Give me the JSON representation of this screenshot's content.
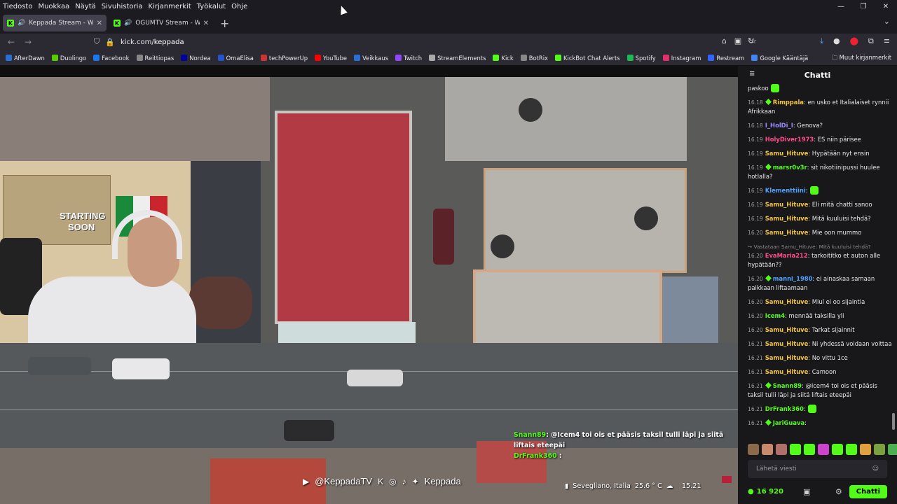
{
  "menubar": [
    "Tiedosto",
    "Muokkaa",
    "Näytä",
    "Sivuhistoria",
    "Kirjanmerkit",
    "Työkalut",
    "Ohje"
  ],
  "tabs": [
    {
      "title": "Keppada Stream - Watch Li"
    },
    {
      "title": "OGUMTV Stream - Watch L"
    }
  ],
  "url": {
    "host": "kick.com/",
    "path": "keppada"
  },
  "bookmarks": [
    {
      "label": "AfterDawn",
      "color": "#2a6fd6"
    },
    {
      "label": "Duolingo",
      "color": "#58cc02"
    },
    {
      "label": "Facebook",
      "color": "#1877f2"
    },
    {
      "label": "Reittiopas",
      "color": "#888888"
    },
    {
      "label": "Nordea",
      "color": "#0000a0"
    },
    {
      "label": "OmaElisa",
      "color": "#2255cc"
    },
    {
      "label": "techPowerUp",
      "color": "#cc3333"
    },
    {
      "label": "YouTube",
      "color": "#ff0000"
    },
    {
      "label": "Veikkaus",
      "color": "#2b6fd6"
    },
    {
      "label": "Twitch",
      "color": "#9146ff"
    },
    {
      "label": "StreamElements",
      "color": "#aaaaaa"
    },
    {
      "label": "Kick",
      "color": "#53fc18"
    },
    {
      "label": "BotRix",
      "color": "#888888"
    },
    {
      "label": "KickBot Chat Alerts",
      "color": "#53fc18"
    },
    {
      "label": "Spotify",
      "color": "#1db954"
    },
    {
      "label": "Instagram",
      "color": "#e1306c"
    },
    {
      "label": "Restream",
      "color": "#3066ff"
    },
    {
      "label": "Google Kääntäjä",
      "color": "#4285f4"
    }
  ],
  "bookmarks_other": "Muut kirjanmerkit",
  "video": {
    "overlay_chat": [
      {
        "user": "Snann89",
        "text": ": @Icem4 toi ois et pääsis taksil tulli läpi ja siitä liftais eteepäi"
      },
      {
        "user": "DrFrank360",
        "text": " :"
      }
    ],
    "handle": "@KeppadaTV",
    "name": "Keppada",
    "location": "Sevegliano, Italia",
    "temperature": "25.6 ° C",
    "time": "15.21",
    "poster_lines": [
      "STARTING",
      "SOON"
    ]
  },
  "chat": {
    "title": "Chatti",
    "messages": [
      {
        "time": "",
        "user": "",
        "color": "#ffffff",
        "text": "paskoo",
        "badge": false,
        "emote": true
      },
      {
        "time": "16.18",
        "user": "Rimppala",
        "color": "#f5c542",
        "text": ": en usko et Italialaiset rynnii Afrikkaan",
        "badge": true
      },
      {
        "time": "16.18",
        "user": "I_HolDi_I",
        "color": "#9a8cff",
        "text": ": Genova?",
        "badge": false
      },
      {
        "time": "16.19",
        "user": "HolyDiver1973",
        "color": "#ff4f8b",
        "text": ": ES niin pärisee",
        "badge": false
      },
      {
        "time": "16.19",
        "user": "Samu_Hituve",
        "color": "#f5c542",
        "text": ": Hypätään nyt ensin",
        "badge": false
      },
      {
        "time": "16.19",
        "user": "marsr0v3r",
        "color": "#53fc18",
        "text": ": sit nikotiinipussi huulee hotlalla?",
        "badge": true
      },
      {
        "time": "16.19",
        "user": "Klementtiini",
        "color": "#4fa3ff",
        "text": ":",
        "badge": false,
        "emote": true
      },
      {
        "time": "16.19",
        "user": "Samu_Hituve",
        "color": "#f5c542",
        "text": ": Eli mitä chatti sanoo",
        "badge": false
      },
      {
        "time": "16.19",
        "user": "Samu_Hituve",
        "color": "#f5c542",
        "text": ": Mitä kuuluisi tehdä?",
        "badge": false
      },
      {
        "time": "16.20",
        "user": "Samu_Hituve",
        "color": "#f5c542",
        "text": ": Mie oon mummo",
        "badge": false
      },
      {
        "reply": "↪ Vastataan Samu_Hituve: Mitä kuuluisi tehdä?",
        "time": "16.20",
        "user": "EvaMaria212",
        "color": "#ff4f8b",
        "text": ": tarkoititko et auton alle hypätään??",
        "badge": false
      },
      {
        "time": "16.20",
        "user": "manni_1980",
        "color": "#4fa3ff",
        "text": ": ei ainaskaa samaan paikkaan liftaamaan",
        "badge": true
      },
      {
        "time": "16.20",
        "user": "Samu_Hituve",
        "color": "#f5c542",
        "text": ": Miul ei oo sijaintia",
        "badge": false
      },
      {
        "time": "16.20",
        "user": "Icem4",
        "color": "#53fc18",
        "text": ": mennää taksilla yli",
        "badge": false
      },
      {
        "time": "16.20",
        "user": "Samu_Hituve",
        "color": "#f5c542",
        "text": ": Tarkat sijainnit",
        "badge": false
      },
      {
        "time": "16.21",
        "user": "Samu_Hituve",
        "color": "#f5c542",
        "text": ": Ni yhdessä voidaan voittaa",
        "badge": false
      },
      {
        "time": "16.21",
        "user": "Samu_Hituve",
        "color": "#f5c542",
        "text": ": No vittu 1ce",
        "badge": false
      },
      {
        "time": "16.21",
        "user": "Samu_Hituve",
        "color": "#f5c542",
        "text": ": Camoon",
        "badge": false
      },
      {
        "time": "16.21",
        "user": "Snann89",
        "color": "#53fc18",
        "text": ": @Icem4 toi ois et pääsis taksil tulli läpi ja siitä liftais eteepäi",
        "badge": true
      },
      {
        "time": "16.21",
        "user": "DrFrank360",
        "color": "#53fc18",
        "text": ":",
        "badge": false,
        "emote": true
      },
      {
        "time": "16.21",
        "user": "JariGuava",
        "color": "#53fc18",
        "text": ":",
        "badge": true
      }
    ],
    "input_placeholder": "Lähetä viesti",
    "viewers": "16 920",
    "send_label": "Chatti"
  }
}
